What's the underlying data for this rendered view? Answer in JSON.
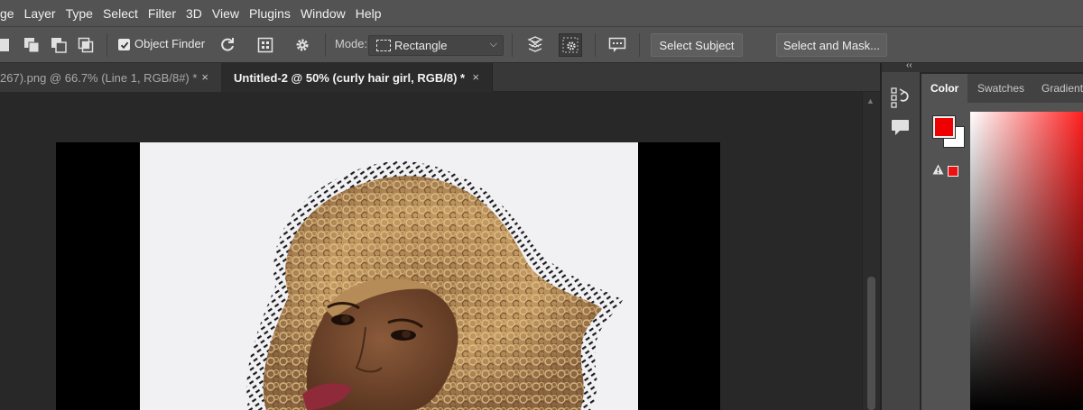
{
  "menu": {
    "items": [
      "ge",
      "Layer",
      "Type",
      "Select",
      "Filter",
      "3D",
      "View",
      "Plugins",
      "Window",
      "Help"
    ]
  },
  "options": {
    "object_finder_label": "Object Finder",
    "object_finder_checked": true,
    "mode_label": "Mode:",
    "mode_value": "Rectangle",
    "select_subject_label": "Select Subject",
    "select_and_mask_label": "Select and Mask..."
  },
  "tabs": [
    {
      "label": "267).png @ 66.7% (Line 1, RGB/8#) *",
      "active": false,
      "close": "×"
    },
    {
      "label": "Untitled-2 @ 50% (curly hair girl, RGB/8) *",
      "active": true,
      "close": "×"
    }
  ],
  "dock": {
    "collapse_glyph": "‹‹"
  },
  "color_panel": {
    "tabs": [
      "Color",
      "Swatches",
      "Gradient"
    ],
    "active_tab": "Color",
    "foreground_color": "#ee0000",
    "background_color": "#ffffff",
    "gamut_warning_icon": "warning-triangle-icon"
  },
  "colors": {
    "menubar_bg": "#535353",
    "workspace_bg": "#282828",
    "active_tab_bg": "#2b2b2b"
  }
}
